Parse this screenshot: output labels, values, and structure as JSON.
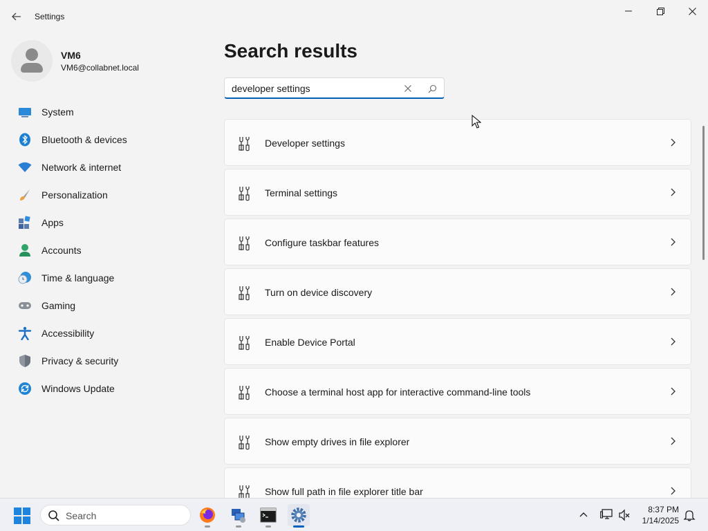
{
  "window": {
    "app_title": "Settings",
    "back_icon": "back-arrow-icon",
    "minimize_icon": "minimize-icon",
    "maximize_icon": "restore-icon",
    "close_icon": "close-icon"
  },
  "profile": {
    "name": "VM6",
    "email": "VM6@collabnet.local"
  },
  "sidebar": {
    "items": [
      {
        "label": "System",
        "icon": "system-icon"
      },
      {
        "label": "Bluetooth & devices",
        "icon": "bluetooth-icon"
      },
      {
        "label": "Network & internet",
        "icon": "wifi-icon"
      },
      {
        "label": "Personalization",
        "icon": "brush-icon"
      },
      {
        "label": "Apps",
        "icon": "apps-icon"
      },
      {
        "label": "Accounts",
        "icon": "accounts-icon"
      },
      {
        "label": "Time & language",
        "icon": "clock-globe-icon"
      },
      {
        "label": "Gaming",
        "icon": "gamepad-icon"
      },
      {
        "label": "Accessibility",
        "icon": "accessibility-icon"
      },
      {
        "label": "Privacy & security",
        "icon": "shield-icon"
      },
      {
        "label": "Windows Update",
        "icon": "update-icon"
      }
    ]
  },
  "main": {
    "title": "Search results",
    "search": {
      "value": "developer settings",
      "placeholder": "",
      "clear_icon": "clear-icon",
      "search_icon": "search-icon"
    },
    "results": [
      {
        "label": "Developer settings",
        "icon": "tools-icon"
      },
      {
        "label": "Terminal settings",
        "icon": "tools-icon"
      },
      {
        "label": "Configure taskbar features",
        "icon": "tools-icon"
      },
      {
        "label": "Turn on device discovery",
        "icon": "tools-icon"
      },
      {
        "label": "Enable Device Portal",
        "icon": "tools-icon"
      },
      {
        "label": "Choose a terminal host app for interactive command-line tools",
        "icon": "tools-icon"
      },
      {
        "label": "Show empty drives in file explorer",
        "icon": "tools-icon"
      },
      {
        "label": "Show full path in file explorer title bar",
        "icon": "tools-icon"
      }
    ]
  },
  "taskbar": {
    "search_label": "Search",
    "apps": [
      {
        "name": "firefox",
        "icon": "firefox-icon"
      },
      {
        "name": "remote-desktop",
        "icon": "network-pc-icon"
      },
      {
        "name": "terminal",
        "icon": "terminal-icon"
      },
      {
        "name": "settings",
        "icon": "gear-icon",
        "active": true
      }
    ],
    "tray": {
      "time": "8:37 PM",
      "date": "1/14/2025"
    }
  },
  "colors": {
    "accent": "#005fb8",
    "background": "#f3f3f3",
    "card": "#fbfbfb"
  }
}
